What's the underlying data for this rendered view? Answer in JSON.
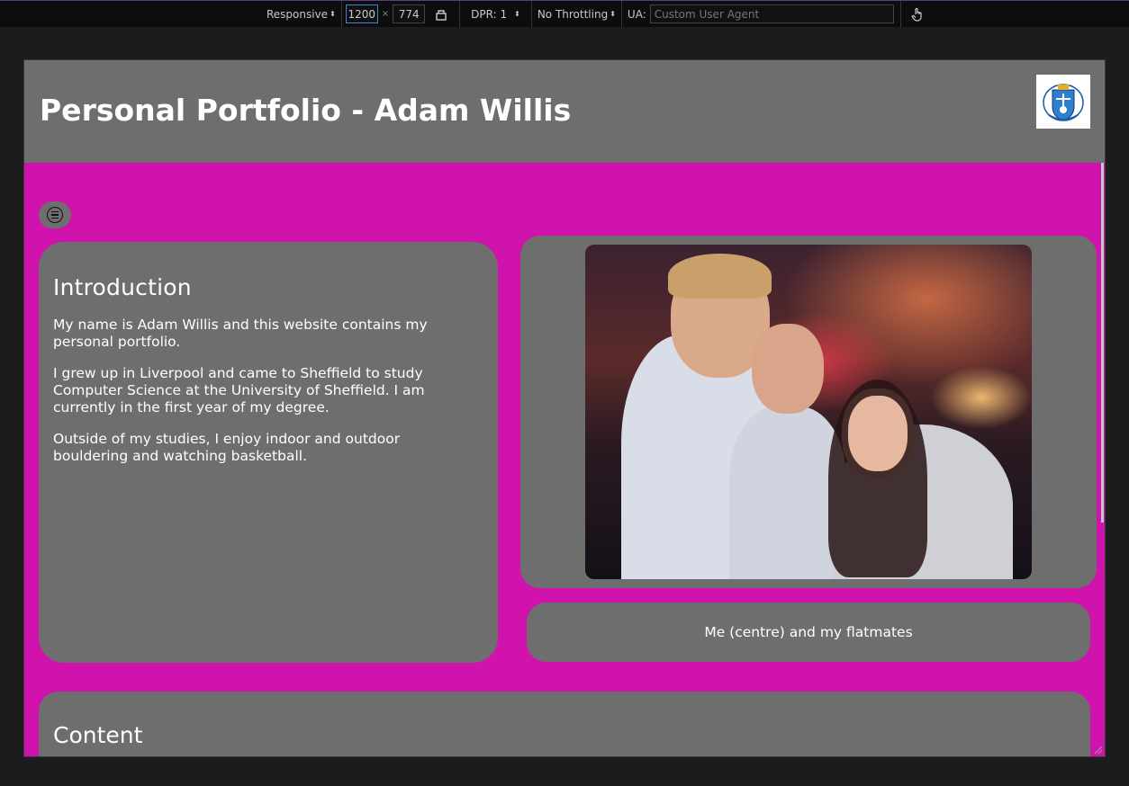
{
  "devtools": {
    "device": "Responsive",
    "width": "1200",
    "height": "774",
    "times": "×",
    "dpr": "DPR: 1",
    "throttling": "No Throttling",
    "ua_label": "UA:",
    "ua_placeholder": "Custom User Agent"
  },
  "site": {
    "title": "Personal Portfolio - Adam Willis",
    "intro": {
      "heading": "Introduction",
      "paragraphs": [
        "My name is Adam Willis and this website contains my personal portfolio.",
        "I grew up in Liverpool and came to Sheffield to study Computer Science at the University of Sheffield. I am currently in the first year of my degree.",
        "Outside of my studies, I enjoy indoor and outdoor bouldering and watching basketball."
      ]
    },
    "photo_caption": "Me (centre) and my flatmates",
    "content_heading": "Content"
  },
  "colors": {
    "page_background": "#d013ad",
    "panel": "#6e6e6e",
    "text": "#ffffff"
  }
}
